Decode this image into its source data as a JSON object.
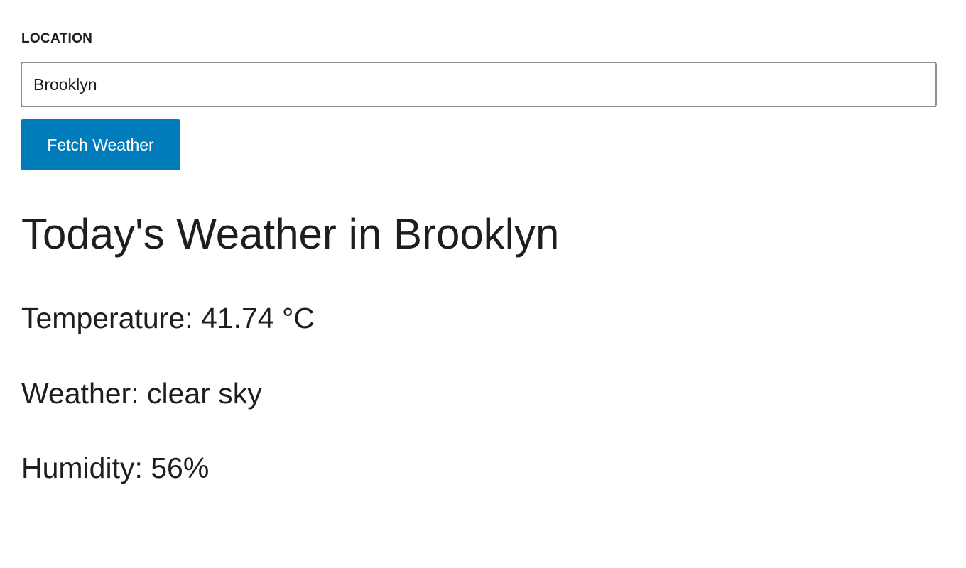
{
  "form": {
    "location_label": "LOCATION",
    "location_value": "Brooklyn",
    "fetch_button_label": "Fetch Weather",
    "button_color": "#007cba"
  },
  "results": {
    "title": "Today's Weather in Brooklyn",
    "temperature_text": "Temperature: 41.74 °C",
    "weather_text": "Weather: clear sky",
    "humidity_text": "Humidity: 56%"
  }
}
